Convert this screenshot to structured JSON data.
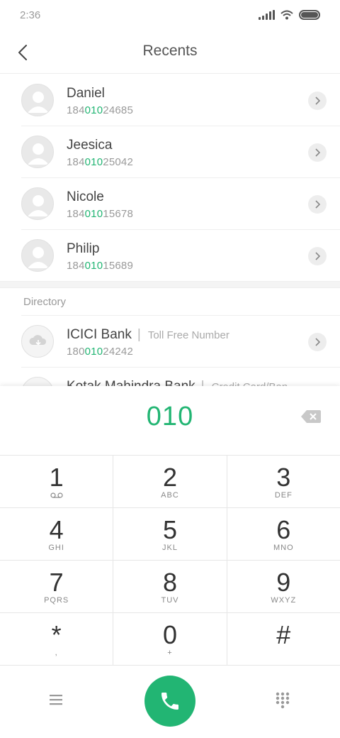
{
  "status_bar": {
    "time": "2:36"
  },
  "header": {
    "title": "Recents"
  },
  "recents": [
    {
      "name": "Daniel",
      "number_prefix": "184",
      "number_match": "010",
      "number_suffix": "24685"
    },
    {
      "name": "Jeesica",
      "number_prefix": "184",
      "number_match": "010",
      "number_suffix": "25042"
    },
    {
      "name": "Nicole",
      "number_prefix": "184",
      "number_match": "010",
      "number_suffix": "15678"
    },
    {
      "name": "Philip",
      "number_prefix": "184",
      "number_match": "010",
      "number_suffix": "15689"
    }
  ],
  "directory": {
    "label": "Directory",
    "items": [
      {
        "name": "ICICI Bank",
        "subtitle": "Toll Free Number",
        "number_prefix": "180",
        "number_match": "010",
        "number_suffix": "24242"
      },
      {
        "name": "Kotak Mahindra Bank",
        "subtitle": "Credit Card/Ban",
        "number_prefix": "",
        "number_match": "",
        "number_suffix": ""
      }
    ]
  },
  "dialer": {
    "input": "010",
    "keys": [
      {
        "digit": "1",
        "letters": ""
      },
      {
        "digit": "2",
        "letters": "ABC"
      },
      {
        "digit": "3",
        "letters": "DEF"
      },
      {
        "digit": "4",
        "letters": "GHI"
      },
      {
        "digit": "5",
        "letters": "JKL"
      },
      {
        "digit": "6",
        "letters": "MNO"
      },
      {
        "digit": "7",
        "letters": "PQRS"
      },
      {
        "digit": "8",
        "letters": "TUV"
      },
      {
        "digit": "9",
        "letters": "WXYZ"
      },
      {
        "digit": "*",
        "letters": ","
      },
      {
        "digit": "0",
        "letters": "+"
      },
      {
        "digit": "#",
        "letters": ""
      }
    ]
  },
  "colors": {
    "accent": "#22b573",
    "text": "#333333",
    "muted": "#9a9a9a"
  }
}
